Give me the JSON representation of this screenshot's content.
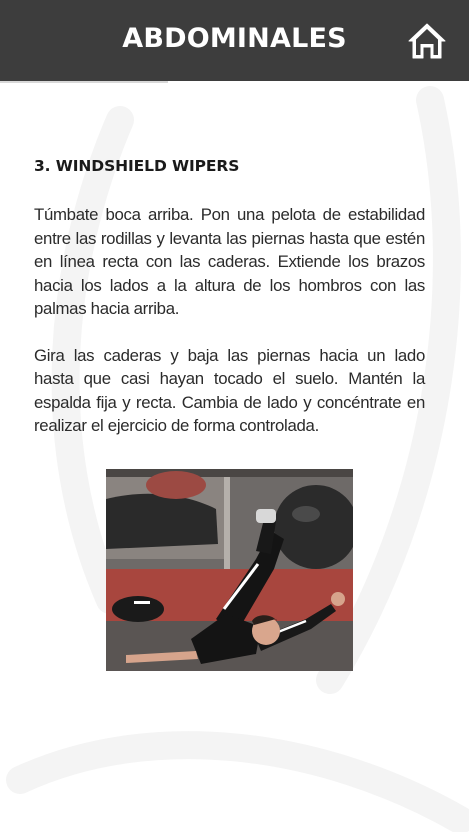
{
  "header": {
    "title": "ABDOMINALES",
    "home_icon": "home-icon"
  },
  "exercise": {
    "title": "3. WINDSHIELD WIPERS",
    "paragraphs": [
      "Túmbate boca arriba. Pon una pelota de estabilidad entre las rodillas y levanta las piernas hasta que estén en línea recta con las caderas. Extiende los brazos hacia los lados a la altura de los hombros con las palmas hacia arriba.",
      "Gira las caderas y baja las piernas hacia un lado hasta que casi hayan tocado el suelo. Mantén la espalda fija y recta. Cambia de lado y concéntrate en realizar el ejercicio de forma controlada."
    ]
  },
  "colors": {
    "header_bg": "#3d3d3d",
    "header_text": "#ffffff",
    "body_text": "#2b2b2b",
    "background": "#ffffff"
  }
}
